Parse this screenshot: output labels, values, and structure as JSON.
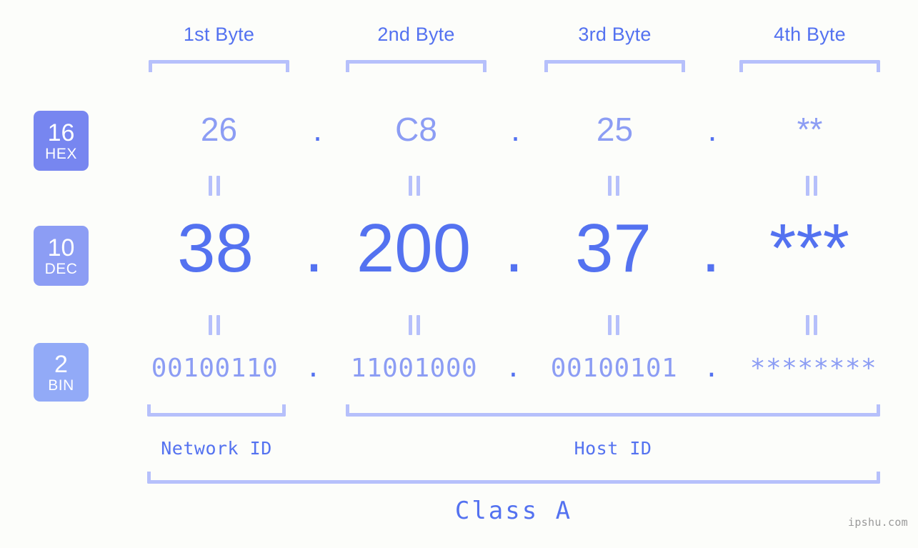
{
  "background_color": "#fcfdfa",
  "accent_color": "#5472f0",
  "accent_light_color": "#8c9df4",
  "bracket_color": "#b6c0fb",
  "byte_headers": [
    {
      "label": "1st Byte"
    },
    {
      "label": "2nd Byte"
    },
    {
      "label": "3rd Byte"
    },
    {
      "label": "4th Byte"
    }
  ],
  "rows": [
    {
      "base_number": "16",
      "base_name": "HEX",
      "badge_color": "#7786f0",
      "values": [
        "26",
        "C8",
        "25",
        "**"
      ],
      "separator": "."
    },
    {
      "base_number": "10",
      "base_name": "DEC",
      "badge_color": "#8c9df4",
      "values": [
        "38",
        "200",
        "37",
        "***"
      ],
      "separator": "."
    },
    {
      "base_number": "2",
      "base_name": "BIN",
      "badge_color": "#92aaf7",
      "values": [
        "00100110",
        "11001000",
        "00100101",
        "********"
      ],
      "separator": "."
    }
  ],
  "equality_marks": {
    "glyph": "||",
    "count_per_row": 4,
    "rows": 2
  },
  "id_sections": [
    {
      "label": "Network ID"
    },
    {
      "label": "Host ID"
    }
  ],
  "class_label": "Class A",
  "watermark": "ipshu.com"
}
